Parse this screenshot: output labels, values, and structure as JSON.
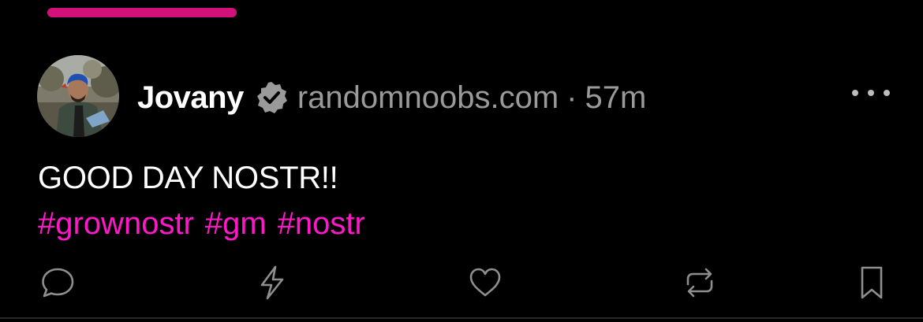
{
  "colors": {
    "background": "#000000",
    "accent": "#d4117a",
    "hashtag": "#ff18c8",
    "muted_text": "#9a9a9a",
    "icon": "#8e8e8e"
  },
  "note": {
    "author": {
      "name": "Jovany",
      "verified_icon": "verified-badge-icon",
      "nip05": "randomnoobs.com",
      "separator": "·",
      "time_ago": "57m"
    },
    "content": "GOOD DAY NOSTR!!",
    "hashtags": [
      "#grownostr",
      "#gm",
      "#nostr"
    ],
    "more_icon": "ellipsis-icon",
    "actions": [
      {
        "icon": "comment-icon"
      },
      {
        "icon": "zap-icon"
      },
      {
        "icon": "heart-icon"
      },
      {
        "icon": "repost-icon"
      },
      {
        "icon": "bookmark-icon"
      }
    ]
  }
}
